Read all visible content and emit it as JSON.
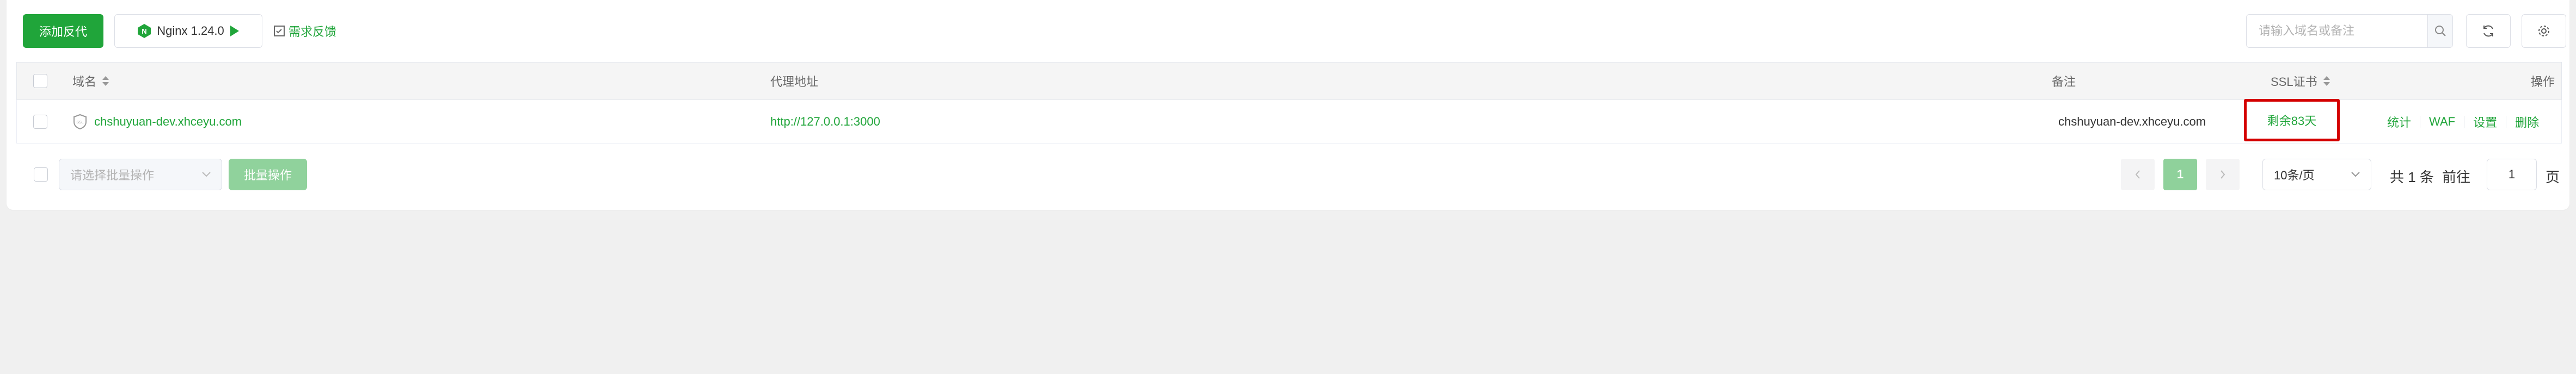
{
  "toolbar": {
    "add_proxy_label": "添加反代",
    "nginx_label": "Nginx 1.24.0",
    "feedback_label": "需求反馈",
    "search_placeholder": "请输入域名或备注"
  },
  "table": {
    "columns": {
      "domain": "域名",
      "proxy": "代理地址",
      "remark": "备注",
      "ssl": "SSL证书",
      "actions": "操作"
    },
    "rows": [
      {
        "domain": "chshuyuan-dev.xhceyu.com",
        "proxy": "http://127.0.0.1:3000",
        "remark": "chshuyuan-dev.xhceyu.com",
        "ssl": "剩余83天",
        "actions": [
          "统计",
          "WAF",
          "设置",
          "删除"
        ]
      }
    ]
  },
  "footer": {
    "batch_select_placeholder": "请选择批量操作",
    "batch_button": "批量操作",
    "current_page": "1",
    "page_size": "10条/页",
    "total_text": "共 1 条",
    "goto_label": "前往",
    "goto_value": "1",
    "page_suffix": "页"
  },
  "colors": {
    "accent": "#20a53a",
    "highlight_border": "#d40000"
  }
}
